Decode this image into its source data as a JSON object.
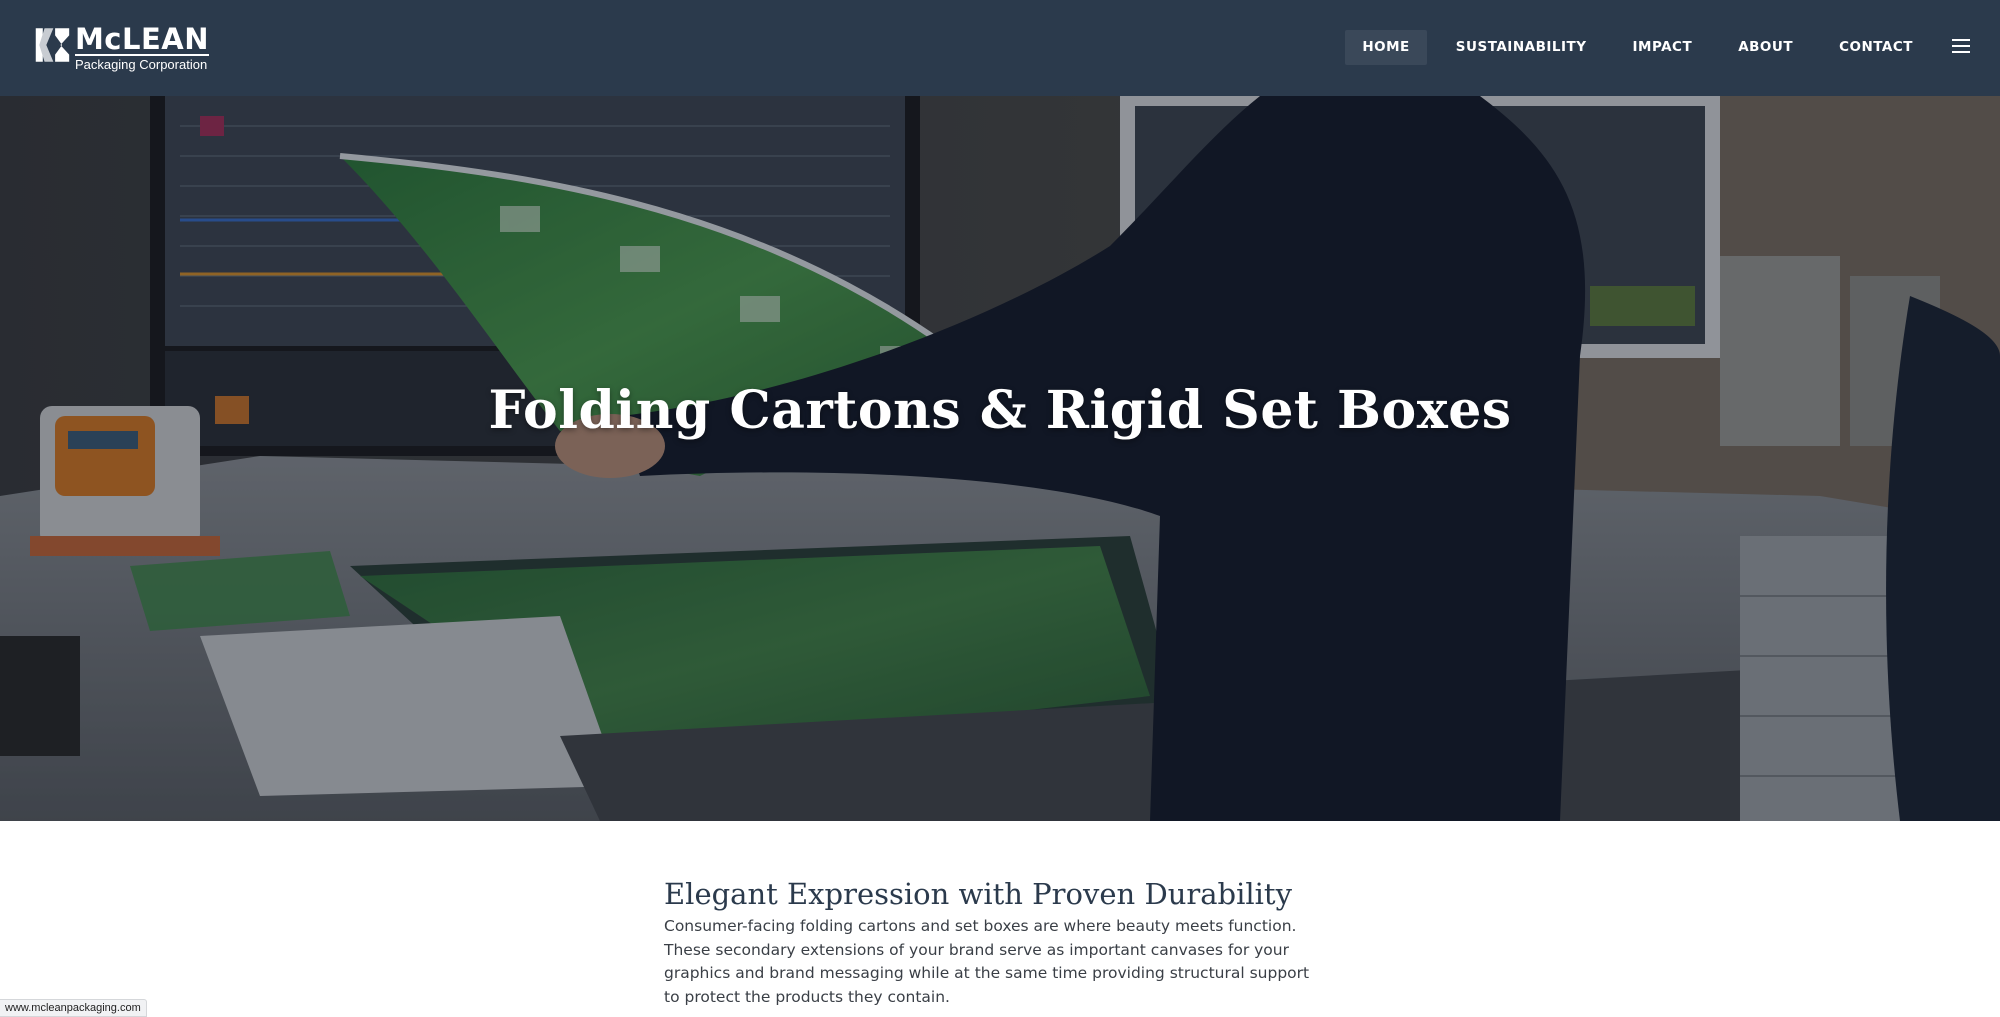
{
  "brand": {
    "name": "McLEAN",
    "subtitle": "Packaging Corporation"
  },
  "nav": {
    "items": [
      {
        "label": "HOME",
        "active": true
      },
      {
        "label": "SUSTAINABILITY",
        "active": false
      },
      {
        "label": "IMPACT",
        "active": false
      },
      {
        "label": "ABOUT",
        "active": false
      },
      {
        "label": "CONTACT",
        "active": false
      }
    ],
    "menu_icon": "hamburger-menu-icon"
  },
  "hero": {
    "title": "Folding Cartons & Rigid Set Boxes"
  },
  "content": {
    "heading": "Elegant Expression with Proven Durability",
    "body": "Consumer-facing folding cartons and set boxes are where beauty meets function. These secondary extensions of your brand serve as important canvases for your graphics and brand messaging while at the same time providing structural support to protect the products they contain."
  },
  "status": {
    "url": "www.mcleanpackaging.com"
  },
  "colors": {
    "header_bg": "#2b3a4c",
    "heading_color": "#2b3a4c",
    "body_text": "#3a3f46"
  }
}
